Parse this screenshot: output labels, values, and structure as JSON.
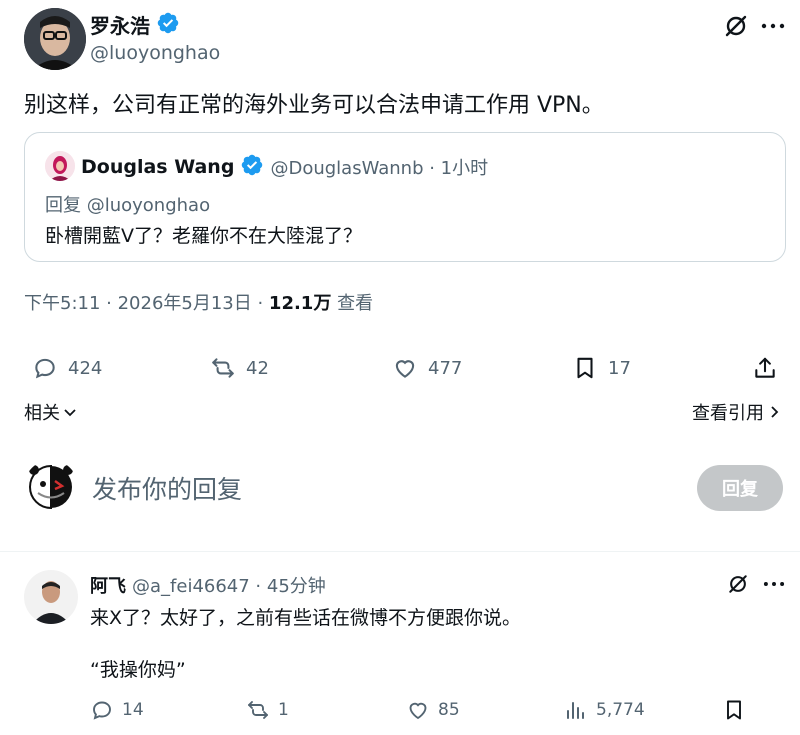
{
  "post": {
    "display_name": "罗永浩",
    "handle": "@luoyonghao",
    "body": "别这样，公司有正常的海外业务可以合法申请工作用 VPN。",
    "quote": {
      "display_name": "Douglas Wang",
      "handle_time": "@DouglasWannb · 1小时",
      "reply_to": "回复 @luoyonghao",
      "body": "卧槽開藍V了？老羅你不在大陸混了？"
    },
    "meta": {
      "time_date": "下午5:11 · 2026年5月13日 · ",
      "views": "12.1万",
      "views_label": " 查看"
    },
    "actions": {
      "replies": "424",
      "reposts": "42",
      "likes": "477",
      "bookmarks": "17"
    }
  },
  "related": {
    "label": "相关",
    "view_quotes": "查看引用"
  },
  "composer": {
    "placeholder": "发布你的回复",
    "reply_button": "回复"
  },
  "reply": {
    "display_name": "阿飞",
    "handle_time": "@a_fei46647 · 45分钟",
    "line1": "来X了？太好了，之前有些话在微博不方便跟你说。",
    "line2": "“我操你妈”",
    "actions": {
      "replies": "14",
      "reposts": "1",
      "likes": "85",
      "views": "5,774"
    }
  },
  "colors": {
    "verified": "#1d9bf0",
    "text": "#0f1419",
    "muted": "#536471",
    "border": "#cfd9de",
    "button_disabled": "#c4c7c9"
  },
  "icons": [
    "grok-icon",
    "more-icon",
    "verified-icon",
    "reply-icon",
    "repost-icon",
    "like-icon",
    "bookmark-icon",
    "share-icon",
    "chevron-down-icon",
    "chevron-right-icon",
    "views-icon"
  ]
}
